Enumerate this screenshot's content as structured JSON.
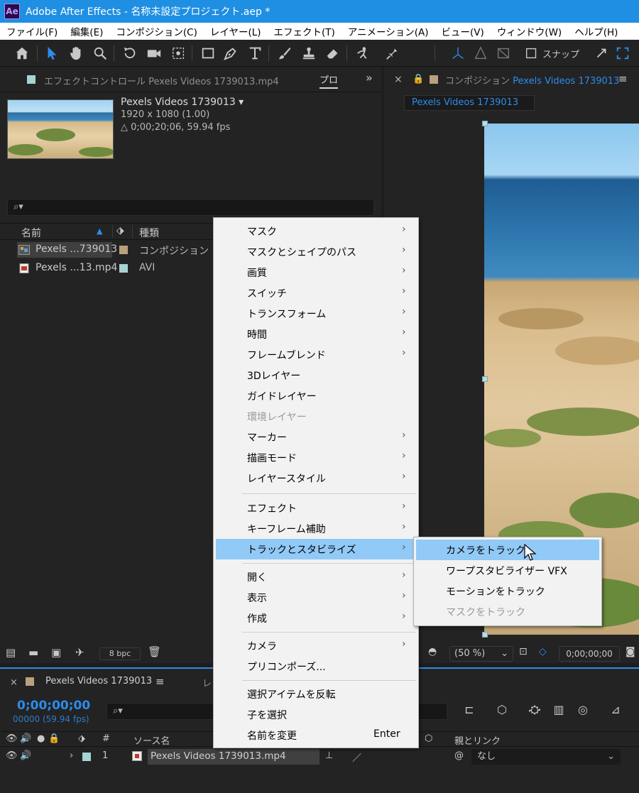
{
  "window": {
    "app_logo": "Ae",
    "title": "Adobe After Effects - 名称未設定プロジェクト.aep *"
  },
  "menubar": {
    "items": [
      "ファイル(F)",
      "編集(E)",
      "コンポジション(C)",
      "レイヤー(L)",
      "エフェクト(T)",
      "アニメーション(A)",
      "ビュー(V)",
      "ウィンドウ(W)",
      "ヘルプ(H)"
    ]
  },
  "toolbar": {
    "icons": [
      "home-icon",
      "selection-tool-icon",
      "hand-tool-icon",
      "zoom-tool-icon",
      "rotate-tool-icon",
      "camera-tool-icon",
      "pan-behind-tool-icon",
      "rectangle-tool-icon",
      "pen-tool-icon",
      "type-tool-icon",
      "brush-tool-icon",
      "clone-stamp-tool-icon",
      "eraser-tool-icon",
      "roto-brush-tool-icon",
      "puppet-pin-tool-icon"
    ],
    "snap_label": "スナップ"
  },
  "effect_controls": {
    "tab_label": "エフェクトコントロール Pexels Videos 1739013.mp4",
    "project_tab_label": "プロ",
    "more_icon": "»"
  },
  "project": {
    "footage_name": "Pexels Videos 1739013 ▾",
    "resolution": "1920 x 1080 (1.00)",
    "duration": "△ 0;00;20;06, 59.94 fps",
    "search_icon": "⌕▾",
    "columns": {
      "name": "名前",
      "type": "種類"
    },
    "rows": [
      {
        "name": "Pexels ...739013",
        "type": "コンポジション",
        "swatch": "#b9a17d",
        "icon": "composition-icon"
      },
      {
        "name": "Pexels ...13.mp4",
        "type": "AVI",
        "swatch": "#a7d3d3",
        "icon": "video-file-icon"
      }
    ],
    "bpc": "8 bpc"
  },
  "composition": {
    "tab_prefix": "コンポジション",
    "tab_name": "Pexels Videos 1739013",
    "pill": "Pexels Videos 1739013",
    "zoom": "(50 %)",
    "time": "0;00;00;00"
  },
  "timeline": {
    "tab_label": "Pexels Videos 1739013",
    "tab2_label": "レ",
    "timecode": "0;00;00;00",
    "fps": "00000 (59.94 fps)",
    "columns": {
      "source_name": "ソース名",
      "parent": "親とリンク",
      "num": "#"
    },
    "layer": {
      "number": "1",
      "name": "Pexels Videos 1739013.mp4",
      "parent": "なし"
    }
  },
  "context_menu": {
    "items": [
      {
        "label": "マスク",
        "submenu": true
      },
      {
        "label": "マスクとシェイプのパス",
        "submenu": true
      },
      {
        "label": "画質",
        "submenu": true
      },
      {
        "label": "スイッチ",
        "submenu": true
      },
      {
        "label": "トランスフォーム",
        "submenu": true
      },
      {
        "label": "時間",
        "submenu": true
      },
      {
        "label": "フレームブレンド",
        "submenu": true
      },
      {
        "label": "3Dレイヤー",
        "submenu": false
      },
      {
        "label": "ガイドレイヤー",
        "submenu": false
      },
      {
        "label": "環境レイヤー",
        "submenu": false,
        "disabled": true
      },
      {
        "label": "マーカー",
        "submenu": true
      },
      {
        "label": "描画モード",
        "submenu": true
      },
      {
        "label": "レイヤースタイル",
        "submenu": true
      },
      {
        "label": "エフェクト",
        "submenu": true
      },
      {
        "label": "キーフレーム補助",
        "submenu": true
      },
      {
        "label": "トラックとスタビライズ",
        "submenu": true,
        "highlighted": true
      },
      {
        "label": "開く",
        "submenu": true
      },
      {
        "label": "表示",
        "submenu": true
      },
      {
        "label": "作成",
        "submenu": true
      },
      {
        "label": "カメラ",
        "submenu": true
      },
      {
        "label": "プリコンポーズ...",
        "submenu": false
      },
      {
        "label": "選択アイテムを反転",
        "submenu": false
      },
      {
        "label": "子を選択",
        "submenu": false
      },
      {
        "label": "名前を変更",
        "submenu": false,
        "shortcut": "Enter"
      }
    ]
  },
  "submenu": {
    "items": [
      {
        "label": "カメラをトラック",
        "highlighted": true
      },
      {
        "label": "ワープスタビライザー VFX"
      },
      {
        "label": "モーションをトラック"
      },
      {
        "label": "マスクをトラック",
        "disabled": true
      }
    ]
  },
  "colors": {
    "accent": "#2d8ceb",
    "title_bar": "#1f8fe3",
    "menu_highlight": "#91c9f7",
    "panel_bg": "#232323"
  }
}
